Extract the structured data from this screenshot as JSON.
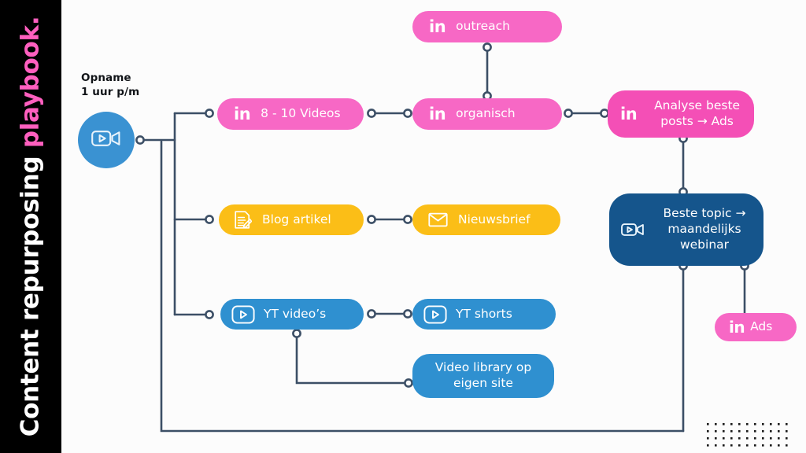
{
  "sidebar": {
    "title_main": "Content repurposing ",
    "title_accent": "playbook.",
    "bg_color": "#000000",
    "accent_color": "#FF5FBF"
  },
  "source": {
    "caption": "Opname\n1 uur p/m",
    "icon": "video-camera-icon",
    "color": "#3A92D2"
  },
  "palette": {
    "pink": "#F768C5",
    "pink_dark": "#F44FB6",
    "yellow": "#FBBE17",
    "blue": "#2F90D0",
    "navy": "#15558C",
    "wire": "#3C4F66",
    "background": "#FCFCFC"
  },
  "nodes": [
    {
      "id": "outreach",
      "label": "outreach",
      "icon": "linkedin-icon",
      "color": "pink"
    },
    {
      "id": "videos",
      "label": "8 - 10  Videos",
      "icon": "linkedin-icon",
      "color": "pink"
    },
    {
      "id": "organisch",
      "label": "organisch",
      "icon": "linkedin-icon",
      "color": "pink"
    },
    {
      "id": "analyse",
      "label": "Analyse beste\nposts → Ads",
      "icon": "linkedin-icon",
      "color": "pink-d"
    },
    {
      "id": "blog",
      "label": "Blog artikel",
      "icon": "document-pen-icon",
      "color": "yellow"
    },
    {
      "id": "nieuwsbrief",
      "label": "Nieuwsbrief",
      "icon": "envelope-icon",
      "color": "yellow"
    },
    {
      "id": "webinar",
      "label": "Beste topic →\nmaandelijks\nwebinar",
      "icon": "video-camera-icon",
      "color": "navy"
    },
    {
      "id": "yt-videos",
      "label": "YT  video’s",
      "icon": "youtube-play-icon",
      "color": "blue"
    },
    {
      "id": "yt-shorts",
      "label": "YT shorts",
      "icon": "youtube-play-icon",
      "color": "blue"
    },
    {
      "id": "video-library",
      "label": "Video library op\neigen site",
      "icon": "none",
      "color": "blue"
    },
    {
      "id": "ads",
      "label": "Ads",
      "icon": "linkedin-icon",
      "color": "pink"
    }
  ]
}
